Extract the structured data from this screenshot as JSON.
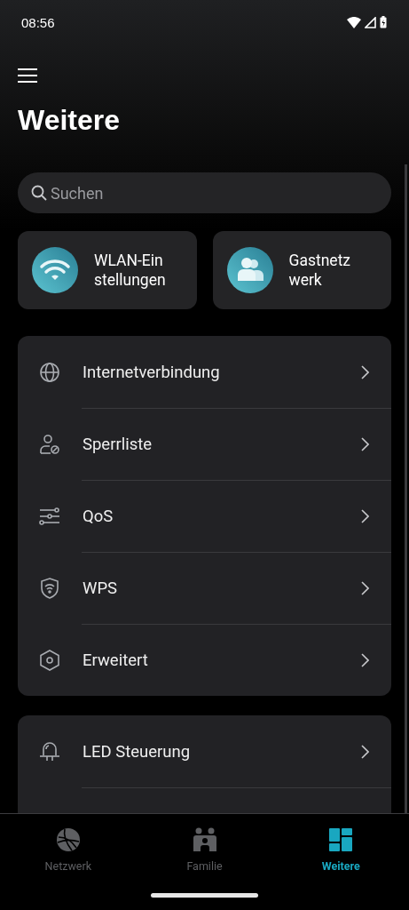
{
  "status_bar": {
    "time": "08:56"
  },
  "header": {
    "title": "Weitere"
  },
  "search": {
    "placeholder": "Suchen"
  },
  "tiles": [
    {
      "lines": [
        "WLAN-Ein",
        "stellungen"
      ]
    },
    {
      "lines": [
        "Gastnetz",
        "werk"
      ]
    }
  ],
  "menu_groups": [
    {
      "items": [
        {
          "label": "Internetverbindung"
        },
        {
          "label": "Sperrliste"
        },
        {
          "label": "QoS"
        },
        {
          "label": "WPS"
        },
        {
          "label": "Erweitert"
        }
      ]
    },
    {
      "items": [
        {
          "label": "LED Steuerung"
        }
      ]
    }
  ],
  "bottom_nav": [
    {
      "label": "Netzwerk",
      "selected": false
    },
    {
      "label": "Familie",
      "selected": false
    },
    {
      "label": "Weitere",
      "selected": true
    }
  ]
}
